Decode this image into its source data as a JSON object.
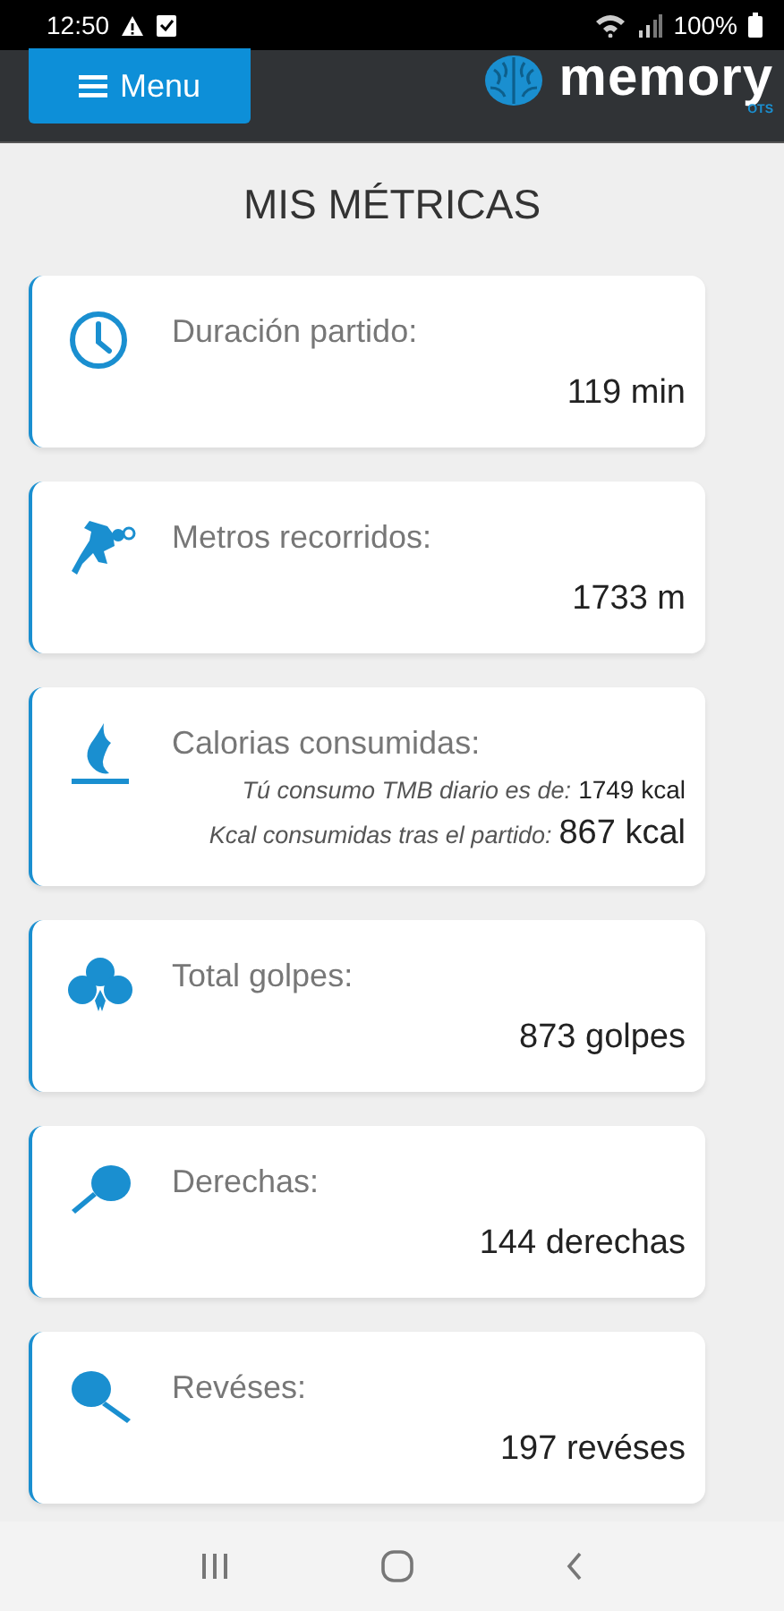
{
  "status_bar": {
    "time": "12:50",
    "battery": "100%"
  },
  "header": {
    "menu_button": "Menu",
    "logo": {
      "name": "memory",
      "sub": "OTS"
    }
  },
  "title": "MIS MÉTRICAS",
  "metrics": [
    {
      "kind": "clock",
      "label": "Duración partido:",
      "value": "119 min"
    },
    {
      "kind": "runner",
      "label": "Metros recorridos:",
      "value": "1733 m"
    },
    {
      "kind": "flame",
      "label": "Calorias consumidas:",
      "details": [
        {
          "kind": "base",
          "label": "Tú consumo TMB diario es de:",
          "value": "1749 kcal"
        },
        {
          "kind": "total",
          "label": "Kcal consumidas tras el partido:",
          "value": "867 kcal"
        }
      ]
    },
    {
      "kind": "balls",
      "label": "Total golpes:",
      "value": "873 golpes"
    },
    {
      "kind": "racket_right",
      "label": "Derechas:",
      "value": "144 derechas"
    },
    {
      "kind": "racket_left",
      "label": "Revéses:",
      "value": "197 revéses"
    }
  ]
}
